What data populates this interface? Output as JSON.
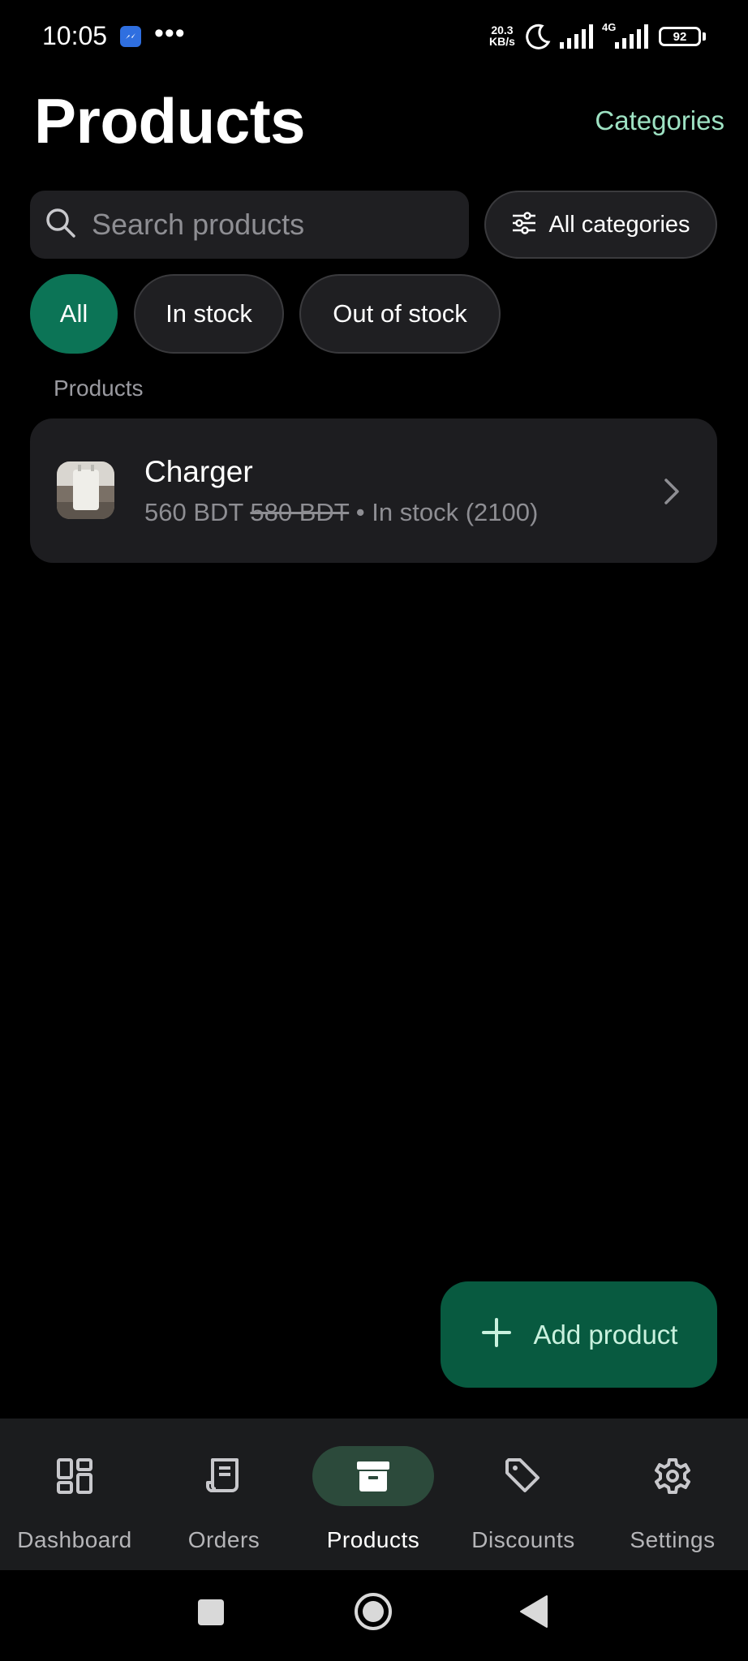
{
  "status_bar": {
    "time": "10:05",
    "net_speed_value": "20.3",
    "net_speed_unit": "KB/s",
    "network_type": "4G",
    "battery": "92"
  },
  "header": {
    "title": "Products",
    "categories_link": "Categories"
  },
  "search": {
    "placeholder": "Search products"
  },
  "category_filter": {
    "label": "All categories"
  },
  "filters": {
    "chips": [
      "All",
      "In stock",
      "Out of stock"
    ],
    "selected": "All"
  },
  "section": {
    "label": "Products"
  },
  "products": [
    {
      "name": "Charger",
      "price": "560 BDT",
      "original_price": "580 BDT",
      "separator": " • ",
      "stock": "In stock (2100)"
    }
  ],
  "fab": {
    "label": "Add product"
  },
  "bottom_nav": {
    "items": [
      "Dashboard",
      "Orders",
      "Products",
      "Discounts",
      "Settings"
    ],
    "active": "Products"
  },
  "colors": {
    "accent": "#0c7456",
    "accent_text": "#9ee2c3",
    "fab": "#085a40",
    "nav_active_pill": "#2c4a3b"
  }
}
